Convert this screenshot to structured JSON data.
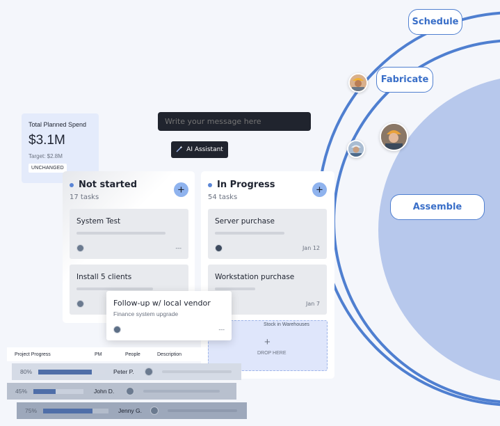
{
  "orbit": {
    "labels": {
      "schedule": "Schedule",
      "fabricate": "Fabricate",
      "assemble": "Assemble"
    },
    "colors": {
      "ring": "#4f7fd0",
      "fill": "#b7c8ec"
    }
  },
  "spend_card": {
    "title": "Total Planned Spend",
    "value": "$3.1M",
    "target": "Target: $2.8M",
    "badge": "UNCHANGED"
  },
  "message": {
    "placeholder": "Write your message here",
    "ai_button": "AI Assistant"
  },
  "columns": {
    "not_started": {
      "title": "Not started",
      "count": "17 tasks",
      "tasks": [
        {
          "title": "System Test",
          "date": "---"
        },
        {
          "title": "Install 5 clients",
          "date": ""
        }
      ]
    },
    "in_progress": {
      "title": "In Progress",
      "count": "54 tasks",
      "tasks": [
        {
          "title": "Server purchase",
          "date": "Jan 12"
        },
        {
          "title": "Workstation purchase",
          "date": "Jan 7"
        }
      ]
    }
  },
  "drop_zone": {
    "label": "Stock in Warehouses",
    "text": "DROP HERE"
  },
  "drag_card": {
    "title": "Follow-up w/ local vendor",
    "subtitle": "Finance system upgrade",
    "date": "---"
  },
  "project_table": {
    "headers": {
      "progress": "Project Progress",
      "pm": "PM",
      "people": "People",
      "description": "Description"
    },
    "rows": [
      {
        "pct": "80%",
        "progress": 0.8,
        "pm": "Peter P."
      },
      {
        "pct": "45%",
        "progress": 0.45,
        "pm": "John D."
      },
      {
        "pct": "75%",
        "progress": 0.75,
        "pm": "Jenny G."
      }
    ]
  }
}
